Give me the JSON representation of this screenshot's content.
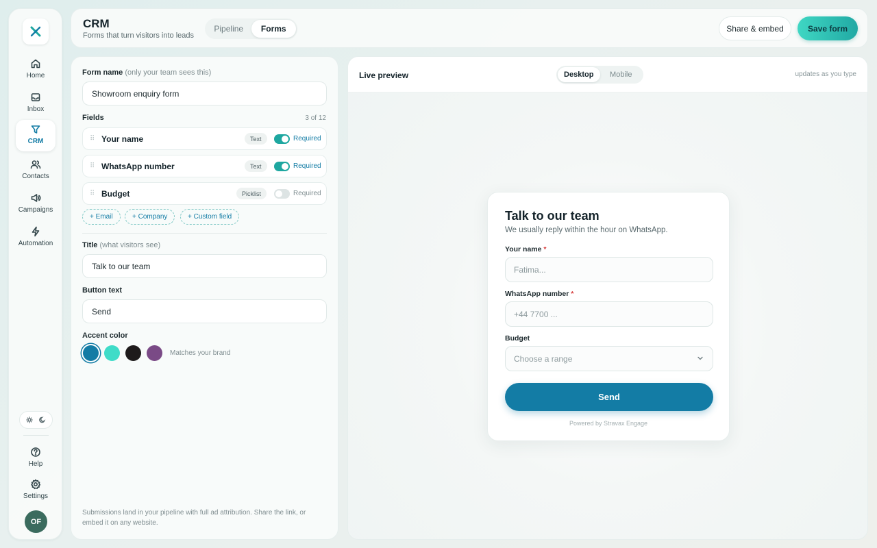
{
  "sidebar": {
    "items": [
      {
        "label": "Home",
        "icon": "home-icon"
      },
      {
        "label": "Inbox",
        "icon": "inbox-icon"
      },
      {
        "label": "CRM",
        "icon": "filter-icon",
        "active": true
      },
      {
        "label": "Contacts",
        "icon": "users-icon"
      },
      {
        "label": "Campaigns",
        "icon": "megaphone-icon"
      },
      {
        "label": "Automation",
        "icon": "bolt-icon"
      }
    ],
    "bottom": [
      {
        "label": "Help",
        "icon": "help-icon"
      },
      {
        "label": "Settings",
        "icon": "gear-icon"
      }
    ],
    "avatar": "OF"
  },
  "header": {
    "title": "CRM",
    "subtitle": "Forms that turn visitors into leads",
    "tabs": [
      "Pipeline",
      "Forms"
    ],
    "active_tab": "Forms",
    "share_label": "Share & embed",
    "save_label": "Save form"
  },
  "editor": {
    "form_name_label": "Form name",
    "form_name_hint": "(only your team sees this)",
    "form_name_value": "Showroom enquiry form",
    "fields_label": "Fields",
    "fields_count": "3 of 12",
    "fields": [
      {
        "name": "Your name",
        "type": "Text",
        "required": true,
        "required_label": "Required"
      },
      {
        "name": "WhatsApp number",
        "type": "Text",
        "required": true,
        "required_label": "Required"
      },
      {
        "name": "Budget",
        "type": "Picklist",
        "required": false,
        "required_label": "Required"
      }
    ],
    "add_chips": [
      "+ Email",
      "+ Company",
      "+ Custom field"
    ],
    "title_label": "Title",
    "title_hint": "(what visitors see)",
    "title_value": "Talk to our team",
    "button_text_label": "Button text",
    "button_text_value": "Send",
    "accent_label": "Accent color",
    "accent_colors": [
      "#137ca5",
      "#3fdcc8",
      "#1e1b1b",
      "#7a4a86"
    ],
    "accent_selected": 0,
    "accent_note": "Matches your brand",
    "footer_note": "Submissions land in your pipeline with full ad attribution. Share the link, or embed it on any website."
  },
  "preview": {
    "title": "Live preview",
    "tabs": [
      "Desktop",
      "Mobile"
    ],
    "active_tab": "Desktop",
    "note": "updates as you type",
    "card": {
      "title": "Talk to our team",
      "subtitle": "We usually reply within the hour on WhatsApp.",
      "fields": [
        {
          "label": "Your name",
          "placeholder": "Fatima...",
          "required": true
        },
        {
          "label": "WhatsApp number",
          "placeholder": "+44 7700 ...",
          "required": true
        },
        {
          "label": "Budget",
          "placeholder": "Choose a range",
          "required": false
        }
      ],
      "button": "Send",
      "powered_by": "Powered by Stravax Engage"
    }
  },
  "colors": {
    "accent": "#137ca5",
    "brand_teal": "#1ea7a0"
  }
}
